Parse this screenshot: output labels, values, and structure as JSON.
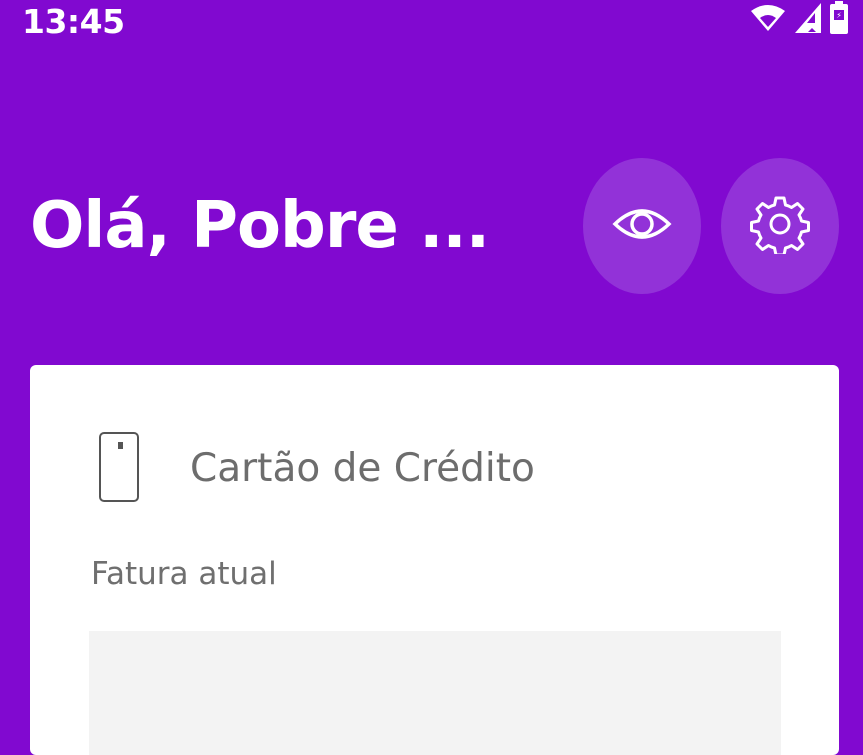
{
  "status_bar": {
    "time": "13:45",
    "icons": [
      "wifi-icon",
      "signal-icon",
      "battery-icon"
    ]
  },
  "header": {
    "greeting": "Olá, Pobre ...",
    "actions": [
      {
        "icon": "eye-icon"
      },
      {
        "icon": "gear-icon"
      }
    ]
  },
  "card": {
    "icon": "phone-card-icon",
    "title": "Cartão de Crédito",
    "subtitle": "Fatura atual"
  },
  "colors": {
    "background": "#8109d0",
    "button": "#9232d8",
    "card": "#ffffff",
    "placeholder": "#f3f3f3"
  }
}
